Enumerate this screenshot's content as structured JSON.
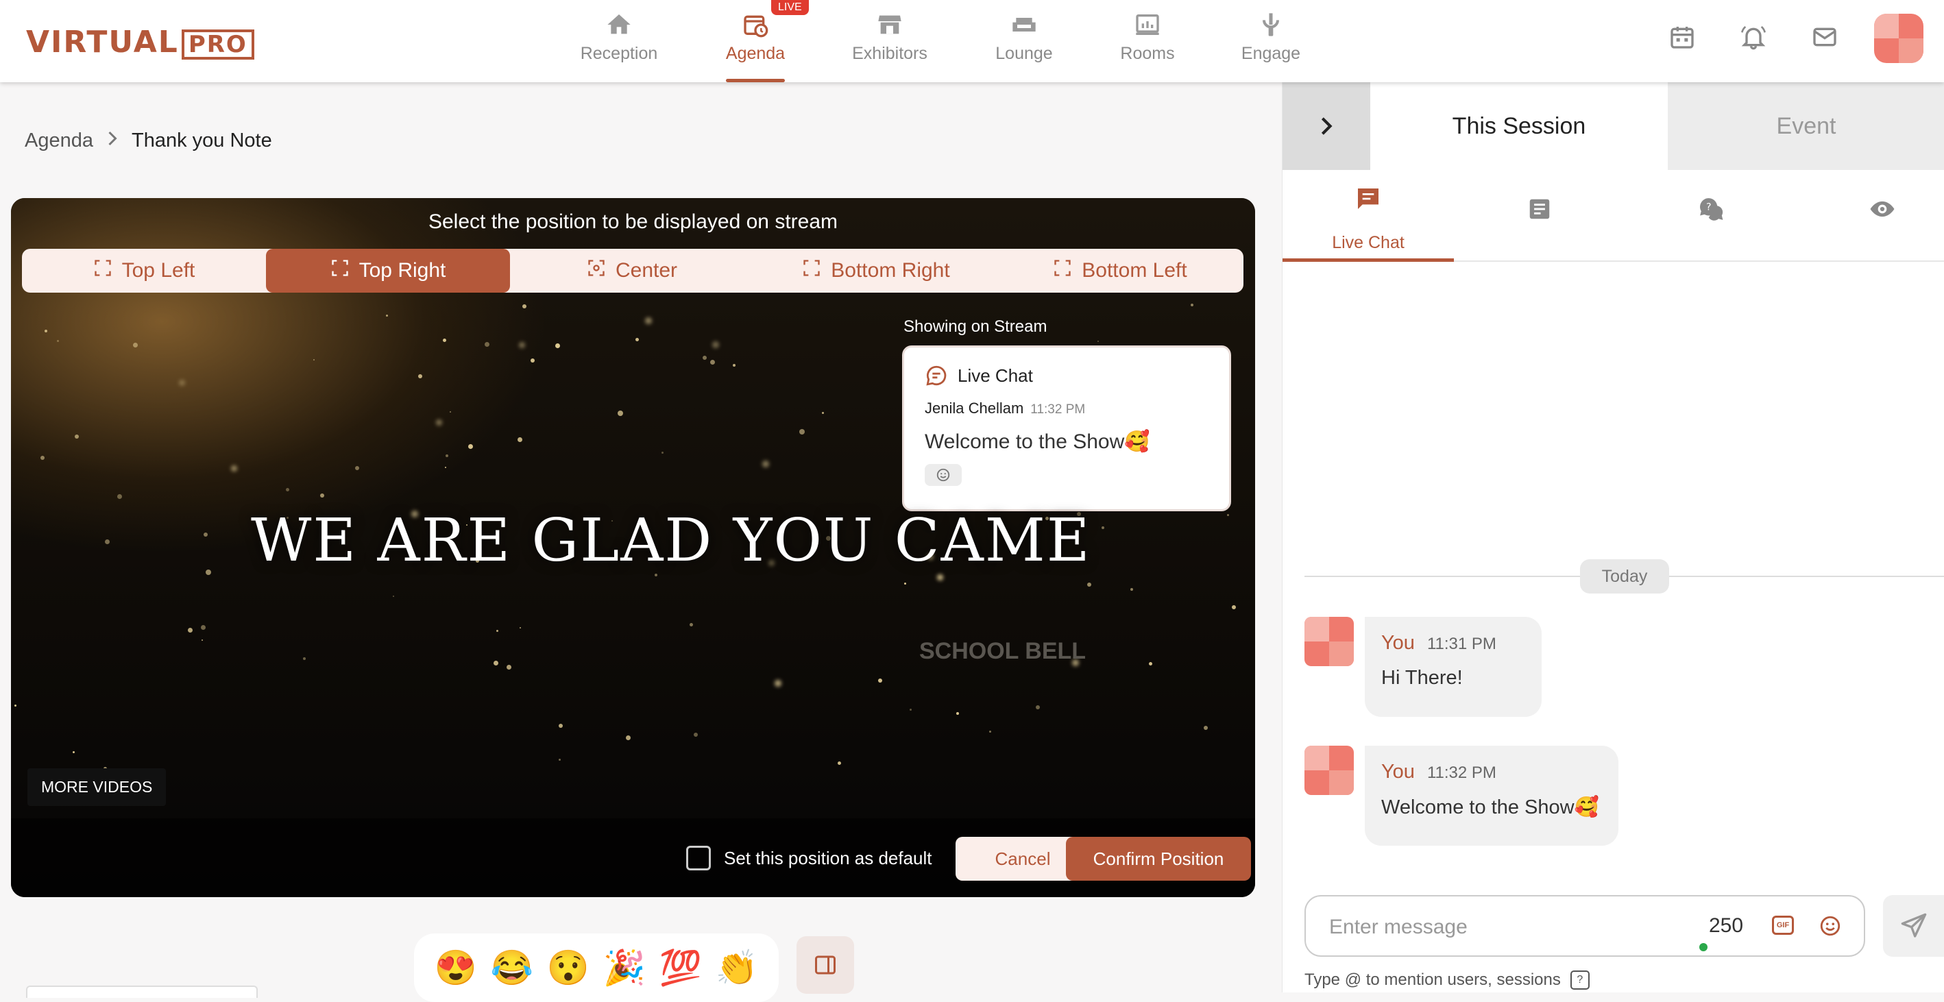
{
  "header": {
    "logo_main": "VIRTUAL",
    "logo_pro": "PRO",
    "nav": [
      {
        "label": "Reception",
        "icon": "home-icon"
      },
      {
        "label": "Agenda",
        "icon": "calendar-clock-icon",
        "badge": "LIVE",
        "active": true
      },
      {
        "label": "Exhibitors",
        "icon": "store-icon"
      },
      {
        "label": "Lounge",
        "icon": "sofa-icon"
      },
      {
        "label": "Rooms",
        "icon": "presentation-icon"
      },
      {
        "label": "Engage",
        "icon": "joystick-icon"
      }
    ],
    "actions": [
      "calendar-icon",
      "bell-icon",
      "mail-icon",
      "avatar"
    ]
  },
  "breadcrumb": {
    "root": "Agenda",
    "current": "Thank you Note"
  },
  "stream": {
    "position_prompt": "Select the position to be displayed on stream",
    "positions": [
      "Top Left",
      "Top Right",
      "Center",
      "Bottom Right",
      "Bottom Left"
    ],
    "selected_position": "Top Right",
    "showing_label": "Showing on Stream",
    "overlay_card": {
      "title": "Live Chat",
      "author": "Jenila Chellam",
      "time": "11:32 PM",
      "message": "Welcome to the Show🥰"
    },
    "headline": "WE ARE GLAD YOU CAME",
    "watermark": "SCHOOL BELL",
    "more_videos": "MORE VIDEOS",
    "default_checkbox_label": "Set this position as default",
    "default_checked": false,
    "cancel_label": "Cancel",
    "confirm_label": "Confirm Position"
  },
  "reactions": [
    "😍",
    "😂",
    "😯",
    "🎉",
    "💯",
    "👏"
  ],
  "panel": {
    "tabs": {
      "this_session": "This Session",
      "event": "Event"
    },
    "inner_tabs": [
      {
        "label": "Live Chat",
        "icon": "chat-icon",
        "active": true
      },
      {
        "label": "",
        "icon": "notes-icon"
      },
      {
        "label": "",
        "icon": "qa-icon"
      },
      {
        "label": "",
        "icon": "eye-icon"
      }
    ],
    "date_divider": "Today",
    "messages": [
      {
        "name": "You",
        "time": "11:31 PM",
        "text": "Hi There!"
      },
      {
        "name": "You",
        "time": "11:32 PM",
        "text": "Welcome to the Show🥰"
      }
    ],
    "input_placeholder": "Enter message",
    "char_count": "250",
    "gif_label": "GIF",
    "hint": "Type @ to mention users, sessions",
    "hint_help": "?"
  },
  "colors": {
    "accent": "#b4583a",
    "live_badge": "#e03b2f",
    "online": "#2aa84a"
  }
}
